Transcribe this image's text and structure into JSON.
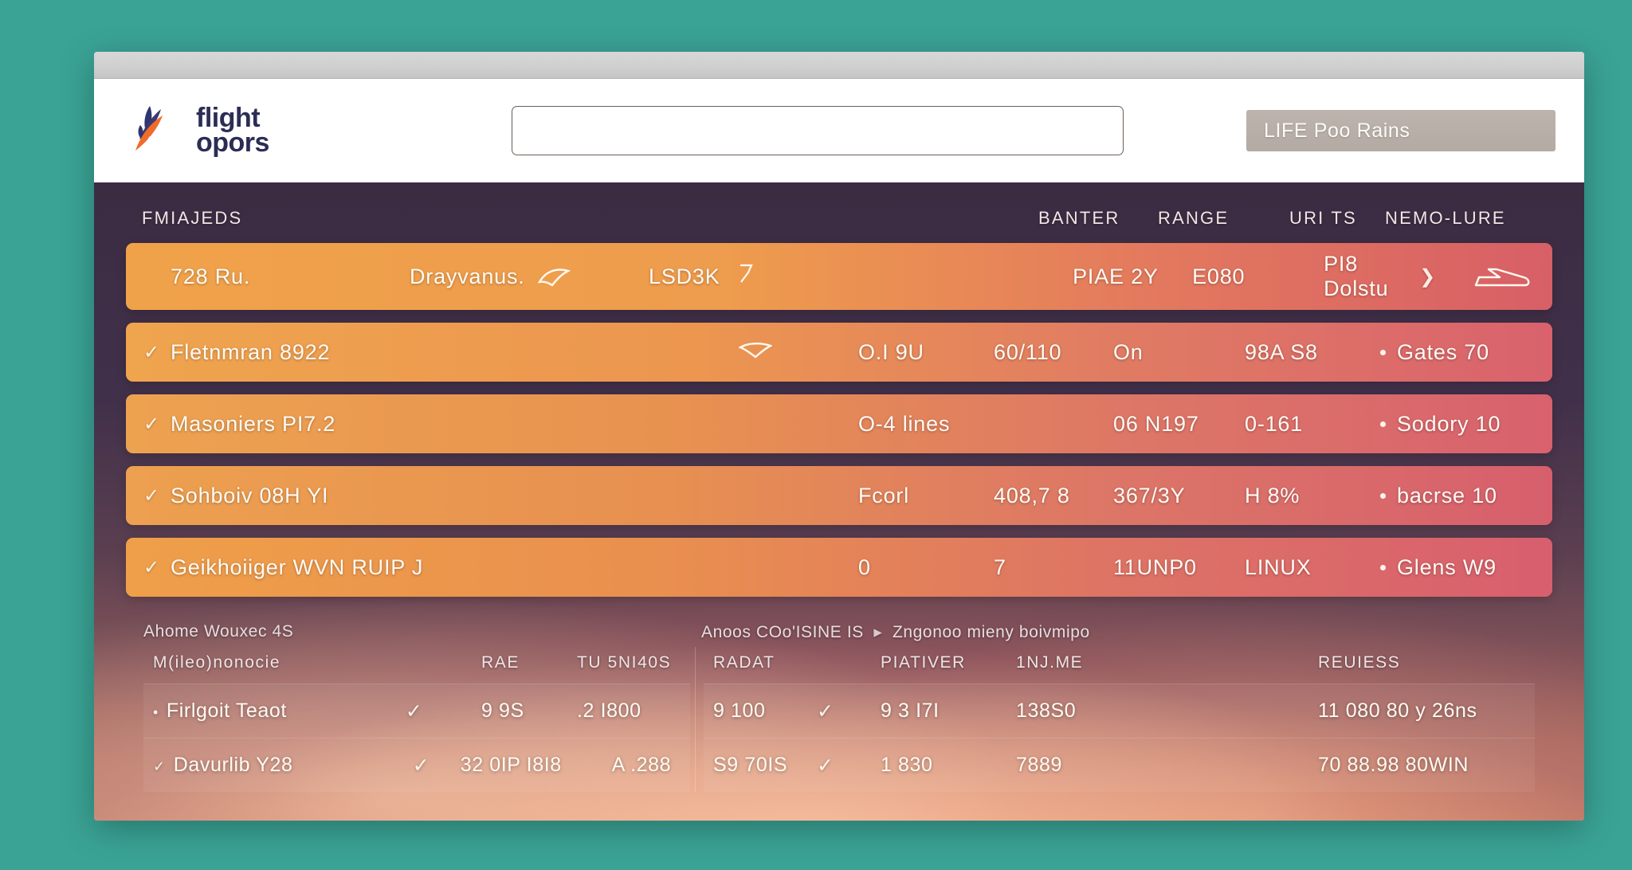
{
  "header": {
    "brand_line1": "flight",
    "brand_line2": "opors",
    "search_value": "",
    "search_placeholder": "",
    "pill_label": "LIFE Poo Rains"
  },
  "flight_table": {
    "columns": [
      {
        "key": "flights",
        "label": "FMIAJEDS"
      },
      {
        "key": "banter",
        "label": "BANTER"
      },
      {
        "key": "range",
        "label": "RANGE"
      },
      {
        "key": "units",
        "label": "URI TS"
      },
      {
        "key": "nature",
        "label": "NEMO-LURE"
      }
    ],
    "rows": [
      {
        "checked": false,
        "name": "728 Ru.",
        "route": "Drayvanus.",
        "route_icon": "bird-icon",
        "code": "LSD3K",
        "code_icon": "flag-icon",
        "banter": "PIAE 2Y",
        "range": "E080",
        "units": "PI8 Dolstu",
        "units_icon": "chevron-right-icon",
        "nature": "",
        "nature_icon": "plane-icon"
      },
      {
        "checked": true,
        "name": "Fletnmran 8922",
        "route": "",
        "route_icon": "bird-icon",
        "code": "O.I 9U",
        "code_icon": "",
        "banter": "60/110",
        "range": "On",
        "units": "98A S8",
        "units_icon": "",
        "nature": "Gates 70",
        "nature_icon": "dot-icon"
      },
      {
        "checked": true,
        "name": "Masoniers PI7.2",
        "route": "",
        "route_icon": "",
        "code": "O-4 lines",
        "code_icon": "",
        "banter": "",
        "range": "06 N197",
        "units": "0-161",
        "units_icon": "",
        "nature": "Sodory 10",
        "nature_icon": "dot-icon"
      },
      {
        "checked": true,
        "name": "Sohboiv 08H YI",
        "route": "",
        "route_icon": "",
        "code": "Fcorl",
        "code_icon": "",
        "banter": "408,7 8",
        "range": "367/3Y",
        "units": "H 8%",
        "units_icon": "",
        "nature": "bacrse 10",
        "nature_icon": "dot-icon"
      },
      {
        "checked": true,
        "name": "Geikhoiiger WVN RUIP J",
        "route": "",
        "route_icon": "",
        "code": "0",
        "code_icon": "",
        "banter": "7",
        "range": "11UNP0",
        "units": "LINUX",
        "units_icon": "",
        "nature": "Glens W9",
        "nature_icon": "dot-icon"
      }
    ]
  },
  "left_pane": {
    "title": "Ahome Wouxec 4S",
    "columns": [
      "M(ileo)nonocie",
      "RAE",
      "TU 5NI40S"
    ],
    "rows": [
      {
        "bullet": "•",
        "name": "Firlgoit Teaot",
        "tick": "✓",
        "v1": "9 9S",
        "v2": ".2 I800"
      },
      {
        "bullet": "✓",
        "name": "Davurlib Y28",
        "tick": "✓",
        "v1": "32 0IP I8I8",
        "v2": "A .288"
      }
    ]
  },
  "right_pane": {
    "title": "Anoos COo'ISINE IS",
    "title_arrow": "▸",
    "title_suffix": "Zngonoo mieny boivmipo",
    "columns": [
      "RADAT",
      "PIATIVER",
      "1NJ.ME",
      "REUIESS"
    ],
    "rows": [
      {
        "v0": "9 100",
        "tick": "✓",
        "v1": "9 3 I7I",
        "v2": "138S0",
        "v3": "11 080 80 y 26ns"
      },
      {
        "v0": "S9 70IS",
        "tick": "✓",
        "v1": "1 830",
        "v2": "7889",
        "v3": "70 88.98 80WIN"
      }
    ]
  },
  "colors": {
    "desktop": "#3aa395",
    "row_start": "#f0a24a",
    "row_end": "#d75f66",
    "panel_dark": "#3b2c42",
    "brand_navy": "#2b2d55",
    "brand_orange": "#ef6c2a"
  }
}
